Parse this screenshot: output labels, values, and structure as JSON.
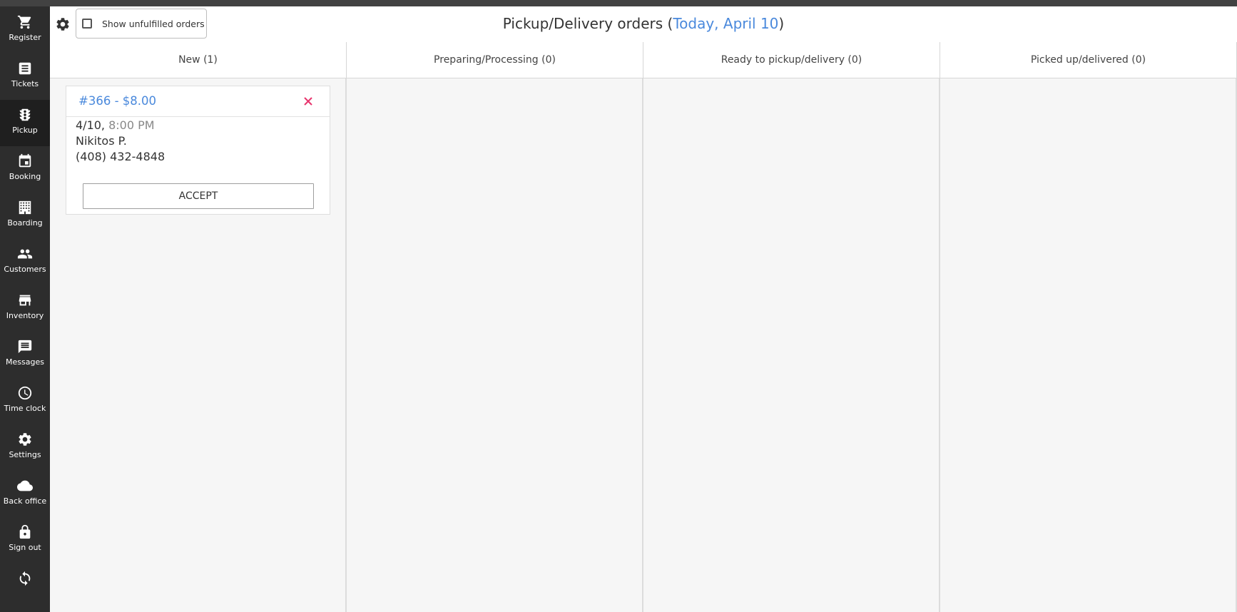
{
  "sidebar": {
    "items": [
      {
        "label": "Register",
        "icon": "cart-icon"
      },
      {
        "label": "Tickets",
        "icon": "ticket-icon"
      },
      {
        "label": "Pickup",
        "icon": "traffic-light-icon",
        "active": true
      },
      {
        "label": "Booking",
        "icon": "calendar-icon"
      },
      {
        "label": "Boarding",
        "icon": "building-icon"
      },
      {
        "label": "Customers",
        "icon": "people-icon"
      },
      {
        "label": "Inventory",
        "icon": "store-icon"
      },
      {
        "label": "Messages",
        "icon": "message-icon"
      },
      {
        "label": "Time clock",
        "icon": "clock-icon"
      },
      {
        "label": "Settings",
        "icon": "gear-icon"
      },
      {
        "label": "Back office",
        "icon": "cloud-icon"
      },
      {
        "label": "Sign out",
        "icon": "lock-icon"
      },
      {
        "label": "",
        "icon": "sync-icon"
      }
    ]
  },
  "header": {
    "toggle_label": "Show unfulfilled orders",
    "toggle_checked": false,
    "title_prefix": "Pickup/Delivery orders (",
    "title_date": "Today, April 10",
    "title_suffix": ")"
  },
  "columns": [
    {
      "label": "New (1)"
    },
    {
      "label": "Preparing/Processing (0)"
    },
    {
      "label": "Ready to pickup/delivery (0)"
    },
    {
      "label": "Picked up/delivered (0)"
    }
  ],
  "order": {
    "id_amount": "#366 - $8.00",
    "date": "4/10,",
    "time": "8:00 PM",
    "customer": "Nikitos P.",
    "phone": "(408) 432-4848",
    "accept_label": "ACCEPT"
  },
  "colors": {
    "accent": "#4a89dc",
    "close": "#e8356d",
    "sidebar_bg": "#2d2d2d"
  }
}
